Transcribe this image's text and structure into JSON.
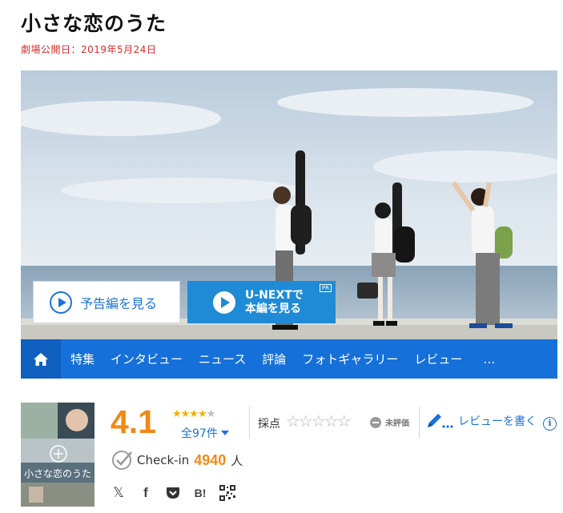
{
  "movie": {
    "title": "小さな恋のうた",
    "release": "劇場公開日：2019年5月24日"
  },
  "hero": {
    "trailer_label": "予告編を見る",
    "unext_line1": "U-NEXTで",
    "unext_line2": "本編を見る",
    "unext_badge": "PR"
  },
  "nav": {
    "home_icon": "home-icon",
    "items": [
      "特集",
      "インタビュー",
      "ニュース",
      "評論",
      "フォトギャラリー",
      "レビュー"
    ],
    "more": "…"
  },
  "poster": {
    "title_text": "小さな恋のうた"
  },
  "rating": {
    "score": "4.1",
    "stars_on": "★★★★",
    "stars_off": "★",
    "count_label": "全97件"
  },
  "user_rating": {
    "label": "採点",
    "stars": "☆☆☆☆☆",
    "unrated_label": "未評価"
  },
  "review": {
    "label": "レビューを書く",
    "info": "i"
  },
  "checkin": {
    "label": "Check-in",
    "count": "4940",
    "unit": "人"
  },
  "share": {
    "x": "𝕏",
    "facebook": "f",
    "hatena": "B!"
  },
  "colors": {
    "accent": "#1a73d9",
    "nav": "#1670d9",
    "score": "#f08a16",
    "release": "#d62b2b",
    "unext": "#1f8bd6"
  }
}
